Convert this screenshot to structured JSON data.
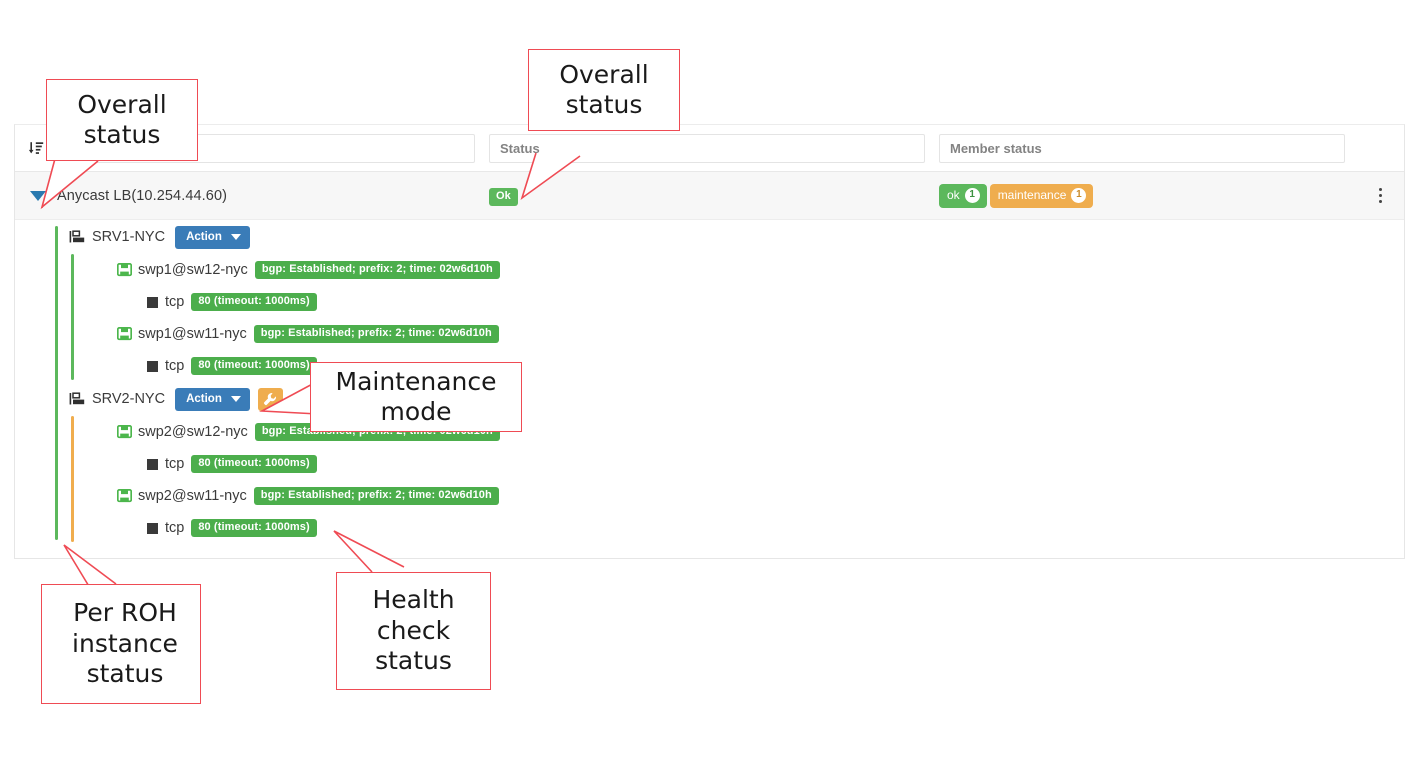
{
  "table": {
    "sort_icon": "sort-descending-icon",
    "filters": [
      {
        "name": "name-filter",
        "placeholder": "",
        "value": ""
      },
      {
        "name": "status-filter",
        "placeholder": "Status",
        "value": ""
      },
      {
        "name": "member-status-filter",
        "placeholder": "Member status",
        "value": ""
      }
    ],
    "group": {
      "expander_icon": "caret-down-icon",
      "name": "Anycast LB(10.254.44.60)",
      "status": "Ok",
      "member_status": [
        {
          "label": "ok",
          "count": "1",
          "color": "#5cb85c"
        },
        {
          "label": "maintenance",
          "count": "1",
          "color": "#efad4e"
        }
      ],
      "row_menu_icon": "kebab-menu-icon"
    },
    "overall_bar_color": "#5cb85c",
    "servers": [
      {
        "icon": "server-icon",
        "name": "SRV1-NYC",
        "action_label": "Action",
        "maintenance": false,
        "instance_bar_color": "#5cb85c",
        "ports": [
          {
            "icon": "ethernet-port-icon",
            "name": "swp1@sw12-nyc",
            "status": "bgp: Established; prefix: 2; time: 02w6d10h",
            "checks": [
              {
                "icon": "tcp-square-icon",
                "name": "tcp",
                "status": "80 (timeout: 1000ms)"
              }
            ]
          },
          {
            "icon": "ethernet-port-icon",
            "name": "swp1@sw11-nyc",
            "status": "bgp: Established; prefix: 2; time: 02w6d10h",
            "checks": [
              {
                "icon": "tcp-square-icon",
                "name": "tcp",
                "status": "80 (timeout: 1000ms)"
              }
            ]
          }
        ]
      },
      {
        "icon": "server-icon",
        "name": "SRV2-NYC",
        "action_label": "Action",
        "maintenance": true,
        "maintenance_icon": "wrench-icon",
        "instance_bar_color": "#f0ad4e",
        "ports": [
          {
            "icon": "ethernet-port-icon",
            "name": "swp2@sw12-nyc",
            "status": "bgp: Established; prefix: 2; time: 02w6d10h",
            "checks": [
              {
                "icon": "tcp-square-icon",
                "name": "tcp",
                "status": "80 (timeout: 1000ms)"
              }
            ]
          },
          {
            "icon": "ethernet-port-icon",
            "name": "swp2@sw11-nyc",
            "status": "bgp: Established; prefix: 2; time: 02w6d10h",
            "checks": [
              {
                "icon": "tcp-square-icon",
                "name": "tcp",
                "status": "80 (timeout: 1000ms)"
              }
            ]
          }
        ]
      }
    ]
  },
  "annotations": [
    {
      "id": "overall-status-left",
      "text": "Overall\nstatus"
    },
    {
      "id": "overall-status-right",
      "text": "Overall\nstatus"
    },
    {
      "id": "maintenance-mode",
      "text": "Maintenance\nmode"
    },
    {
      "id": "per-roh-instance",
      "text": "Per ROH\ninstance\nstatus"
    },
    {
      "id": "health-check-status",
      "text": "Health\ncheck\nstatus"
    }
  ],
  "colors": {
    "annotation_border": "#ef4b54",
    "ok_green": "#5cb85c",
    "maintenance_orange": "#efad4e",
    "action_blue": "#3a7cb8"
  }
}
